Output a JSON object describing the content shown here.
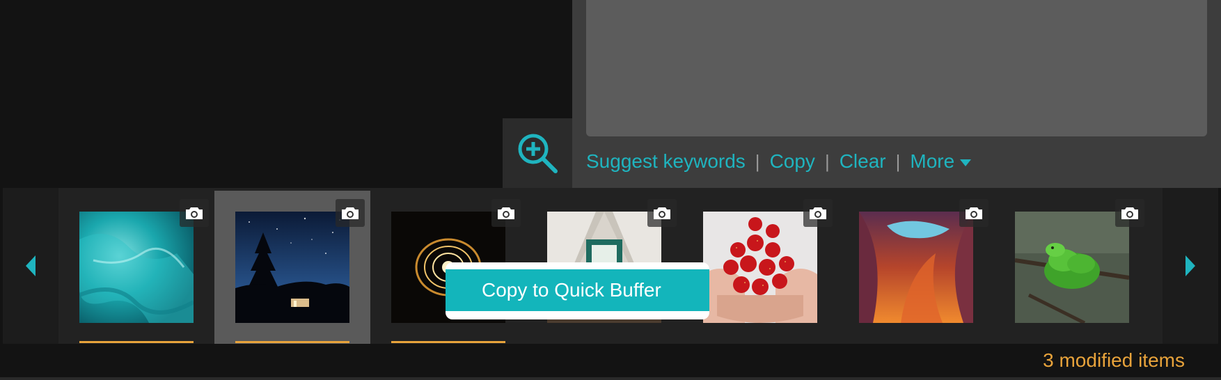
{
  "keywords": {
    "value": "",
    "actions": {
      "suggest": "Suggest keywords",
      "copy": "Copy",
      "clear": "Clear",
      "more": "More",
      "separator": "|"
    }
  },
  "zoom": {
    "icon": "zoom-in-icon"
  },
  "filmstrip": {
    "nav_left_icon": "triangle-left-icon",
    "nav_right_icon": "triangle-right-icon",
    "items": [
      {
        "subject": "turquoise water",
        "modified": true,
        "selected": false,
        "badge_icon": "camera-icon"
      },
      {
        "subject": "night sky with trees",
        "modified": true,
        "selected": true,
        "badge_icon": "camera-icon"
      },
      {
        "subject": "golden light swirl",
        "modified": true,
        "selected": false,
        "badge_icon": "camera-icon"
      },
      {
        "subject": "tent doorway",
        "modified": false,
        "selected": false,
        "badge_icon": "camera-icon"
      },
      {
        "subject": "hands holding strawberries",
        "modified": false,
        "selected": false,
        "badge_icon": "camera-icon"
      },
      {
        "subject": "red canyon",
        "modified": false,
        "selected": false,
        "badge_icon": "camera-icon"
      },
      {
        "subject": "green snake on branch",
        "modified": false,
        "selected": false,
        "badge_icon": "camera-icon"
      }
    ]
  },
  "popup": {
    "label": "Copy to Quick Buffer"
  },
  "status": {
    "modified_text": "3 modified items"
  },
  "colors": {
    "accent": "#1fb4bf",
    "modified": "#e8a33b",
    "popup": "#13b5bb"
  }
}
